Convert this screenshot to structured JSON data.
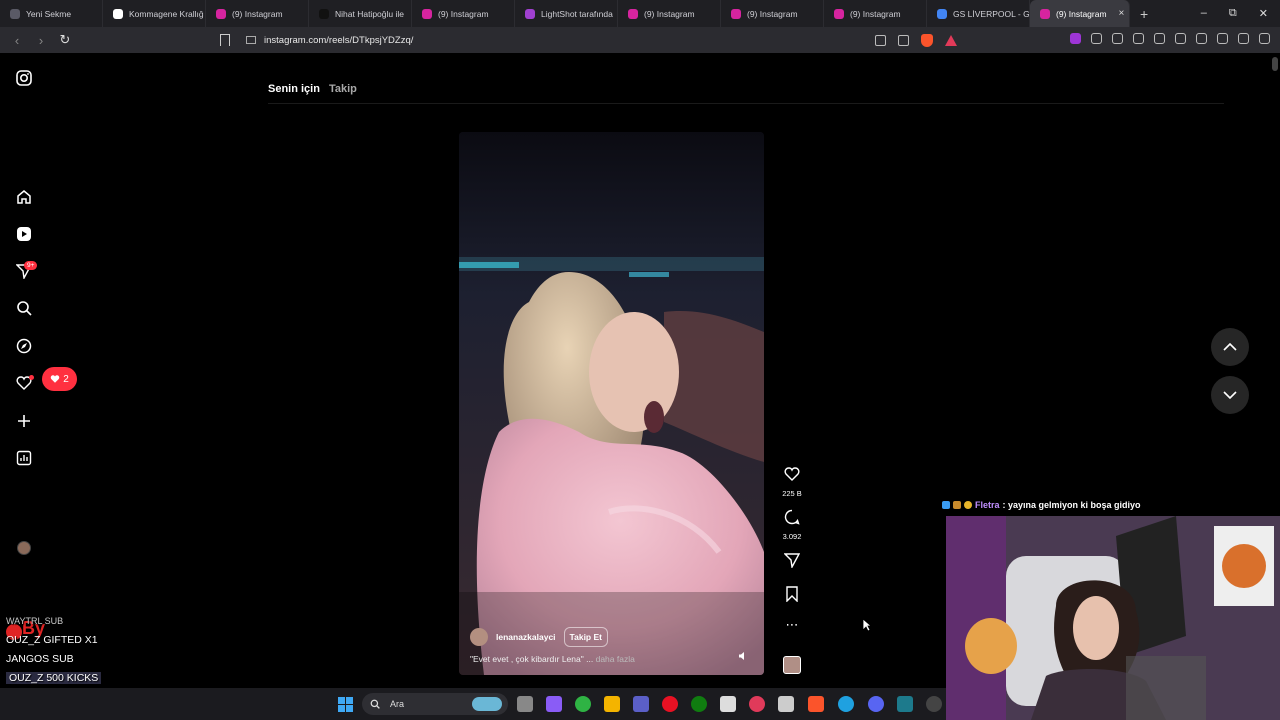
{
  "browser": {
    "tabs": [
      {
        "label": "Yeni Sekme",
        "color": "#5a5a66"
      },
      {
        "label": "Kommagene Krallığ",
        "color": "#ffffff"
      },
      {
        "label": "(9) Instagram",
        "color": "#d6249f"
      },
      {
        "label": "Nihat Hatipoğlu ile",
        "color": "#111111"
      },
      {
        "label": "(9) Instagram",
        "color": "#d6249f"
      },
      {
        "label": "LightShot tarafında",
        "color": "#a040d0"
      },
      {
        "label": "(9) Instagram",
        "color": "#d6249f"
      },
      {
        "label": "(9) Instagram",
        "color": "#d6249f"
      },
      {
        "label": "(9) Instagram",
        "color": "#d6249f"
      },
      {
        "label": "GS LİVERPOOL - Go",
        "color": "#4285f4"
      },
      {
        "label": "(9) Instagram",
        "color": "#d6249f",
        "active": true
      }
    ],
    "new_tab": "+",
    "url": "instagram.com/reels/DTkpsjYDZzq/"
  },
  "rail": {
    "notif_badge": "9+",
    "activity_count": "2"
  },
  "feed": {
    "tab_for_you": "Senin için",
    "tab_following": "Takip"
  },
  "reel": {
    "username": "lenanazkalayci",
    "follow_label": "Takip Et",
    "caption": "\"Evet evet , çok kibardır Lena\" ...",
    "more_label": "daha fazla",
    "likes": "225 B",
    "comments": "3.092"
  },
  "stream": {
    "chat_user": "Fletra",
    "chat_text": ": yayına gelmiyon ki boşa gidiyo",
    "log_lines": [
      {
        "text": "WAYTRL SUB",
        "style": "dim"
      },
      {
        "text": "OUZ_Z  GIFTED X1",
        "style": "normal"
      },
      {
        "text": "JANGOS  SUB",
        "style": "normal"
      },
      {
        "text": "OUZ_Z  500 KICKS",
        "style": "hl"
      }
    ]
  },
  "taskbar": {
    "search_label": "Ara"
  },
  "colors": {
    "accent_red": "#ff3040",
    "chat_name": "#c18fff"
  }
}
